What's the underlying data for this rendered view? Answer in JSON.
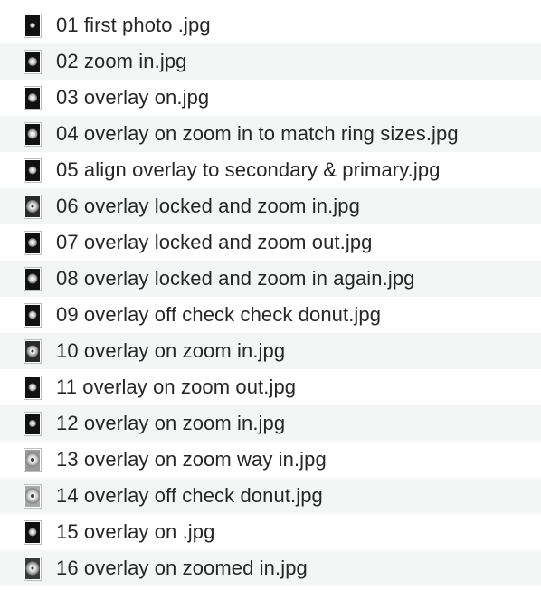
{
  "files": [
    {
      "name": "01 first photo .jpg",
      "icon": "photo-thumbnail-icon"
    },
    {
      "name": "02 zoom in.jpg",
      "icon": "photo-thumbnail-icon"
    },
    {
      "name": "03 overlay on.jpg",
      "icon": "photo-thumbnail-icon"
    },
    {
      "name": "04 overlay on zoom in to match ring sizes.jpg",
      "icon": "photo-thumbnail-icon"
    },
    {
      "name": "05 align overlay to secondary & primary.jpg",
      "icon": "photo-thumbnail-icon"
    },
    {
      "name": "06 overlay locked and zoom in.jpg",
      "icon": "photo-thumbnail-icon"
    },
    {
      "name": "07 overlay locked and zoom out.jpg",
      "icon": "photo-thumbnail-icon"
    },
    {
      "name": "08 overlay locked and zoom in again.jpg",
      "icon": "photo-thumbnail-icon"
    },
    {
      "name": "09 overlay off check check donut.jpg",
      "icon": "photo-thumbnail-icon"
    },
    {
      "name": "10 overlay on zoom in.jpg",
      "icon": "photo-thumbnail-icon"
    },
    {
      "name": "11 overlay on zoom out.jpg",
      "icon": "photo-thumbnail-icon"
    },
    {
      "name": "12 overlay on zoom in.jpg",
      "icon": "photo-thumbnail-icon"
    },
    {
      "name": "13 overlay on zoom way in.jpg",
      "icon": "photo-thumbnail-icon"
    },
    {
      "name": "14 overlay off check donut.jpg",
      "icon": "photo-thumbnail-icon"
    },
    {
      "name": "15 overlay on .jpg",
      "icon": "photo-thumbnail-icon"
    },
    {
      "name": "16 overlay on zoomed in.jpg",
      "icon": "photo-thumbnail-icon"
    }
  ],
  "colors": {
    "row_alt_background": "#f4f5f5",
    "text": "#262626"
  }
}
